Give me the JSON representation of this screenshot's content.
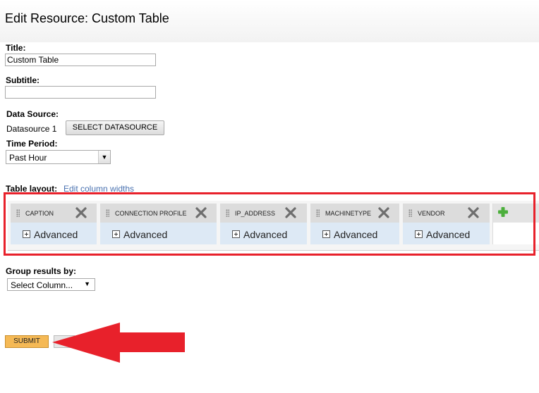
{
  "page": {
    "title": "Edit Resource: Custom Table"
  },
  "form": {
    "title_label": "Title:",
    "title_value": "Custom Table",
    "subtitle_label": "Subtitle:",
    "subtitle_value": "",
    "datasource_label": "Data Source:",
    "datasource_value": "Datasource 1",
    "datasource_button": "SELECT DATASOURCE",
    "time_period_label": "Time Period:",
    "time_period_value": "Past Hour"
  },
  "table_layout": {
    "label": "Table layout:",
    "edit_link": "Edit column widths",
    "columns": [
      {
        "name": "CAPTION",
        "advanced": "Advanced"
      },
      {
        "name": "CONNECTION PROFILE",
        "advanced": "Advanced"
      },
      {
        "name": "IP_ADDRESS",
        "advanced": "Advanced"
      },
      {
        "name": "MACHINETYPE",
        "advanced": "Advanced"
      },
      {
        "name": "VENDOR",
        "advanced": "Advanced"
      }
    ]
  },
  "grouping": {
    "label": "Group results by:",
    "select_value": "Select Column..."
  },
  "actions": {
    "submit_label": "SUBMIT"
  },
  "colors": {
    "highlight": "#e8212b",
    "submit_bg": "#f5b955",
    "link": "#4a72b0"
  },
  "icons": [
    "grip-icon",
    "remove-column-icon",
    "expand-icon",
    "add-column-icon",
    "chevron-down-icon",
    "annotation-arrow"
  ]
}
